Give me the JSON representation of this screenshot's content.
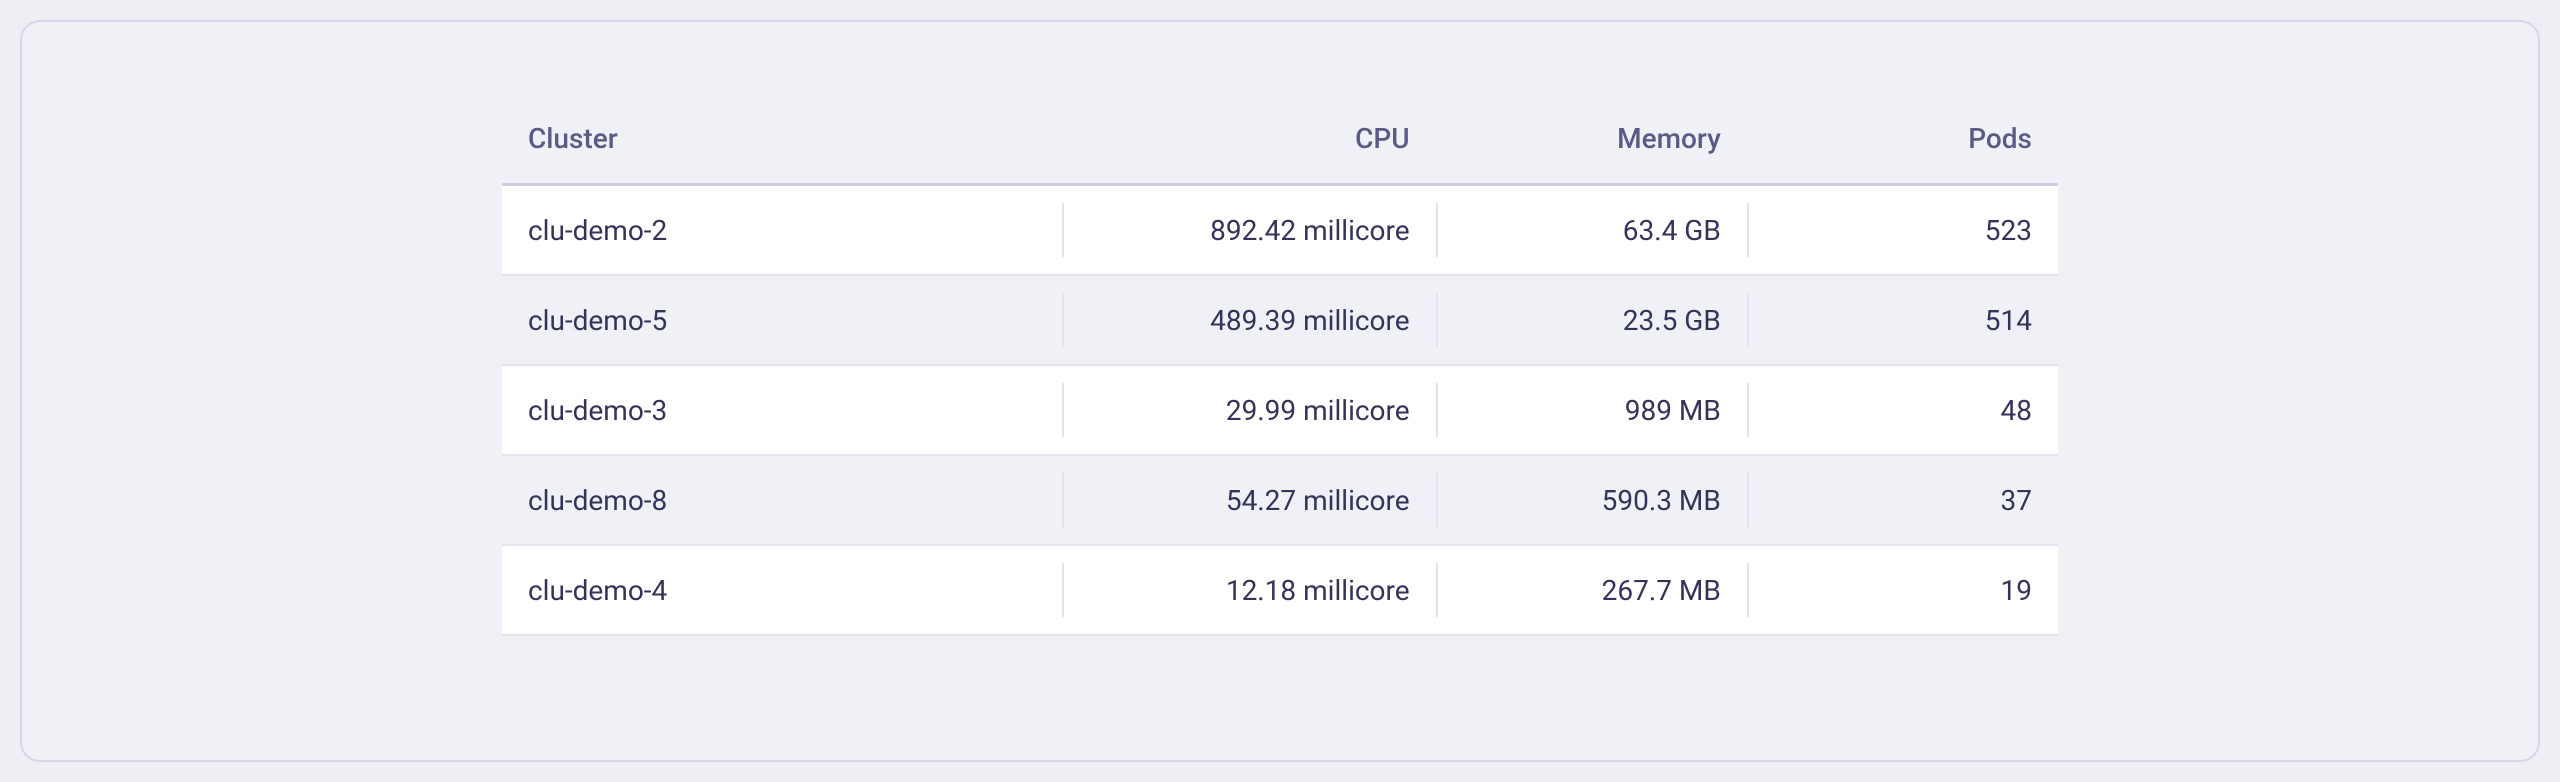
{
  "table": {
    "headers": {
      "cluster": "Cluster",
      "cpu": "CPU",
      "memory": "Memory",
      "pods": "Pods"
    },
    "rows": [
      {
        "cluster": "clu-demo-2",
        "cpu": "892.42 millicore",
        "memory": "63.4 GB",
        "pods": "523"
      },
      {
        "cluster": "clu-demo-5",
        "cpu": "489.39 millicore",
        "memory": "23.5 GB",
        "pods": "514"
      },
      {
        "cluster": "clu-demo-3",
        "cpu": "29.99 millicore",
        "memory": "989 MB",
        "pods": "48"
      },
      {
        "cluster": "clu-demo-8",
        "cpu": "54.27 millicore",
        "memory": "590.3 MB",
        "pods": "37"
      },
      {
        "cluster": "clu-demo-4",
        "cpu": "12.18 millicore",
        "memory": "267.7 MB",
        "pods": "19"
      }
    ]
  },
  "chart_data": {
    "type": "table",
    "columns": [
      "Cluster",
      "CPU",
      "Memory",
      "Pods"
    ],
    "rows": [
      [
        "clu-demo-2",
        "892.42 millicore",
        "63.4 GB",
        523
      ],
      [
        "clu-demo-5",
        "489.39 millicore",
        "23.5 GB",
        514
      ],
      [
        "clu-demo-3",
        "29.99 millicore",
        "989 MB",
        48
      ],
      [
        "clu-demo-8",
        "54.27 millicore",
        "590.3 MB",
        37
      ],
      [
        "clu-demo-4",
        "12.18 millicore",
        "267.7 MB",
        19
      ]
    ]
  }
}
